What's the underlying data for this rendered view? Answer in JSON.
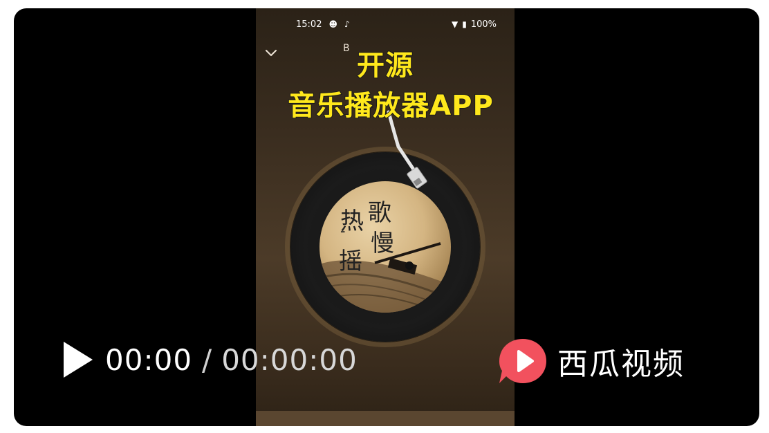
{
  "status_bar": {
    "time": "15:02",
    "battery": "100%",
    "wifi_icon": "wifi-icon",
    "battery_icon": "battery-icon",
    "music_icon": "music-note-icon"
  },
  "app": {
    "song_title_stub": "B",
    "collapse_icon": "chevron-down-icon"
  },
  "overlay": {
    "line1": "开源",
    "line2": "音乐播放器APP"
  },
  "album": {
    "chars": [
      "热",
      "歌",
      "慢",
      "摇",
      "-"
    ]
  },
  "player": {
    "current_time": "00:00",
    "separator": "/",
    "total_time": "00:00:00",
    "play_icon": "play-icon"
  },
  "brand": {
    "name": "西瓜视频",
    "logo_icon": "xigua-video-logo",
    "logo_color": "#f2515e"
  }
}
